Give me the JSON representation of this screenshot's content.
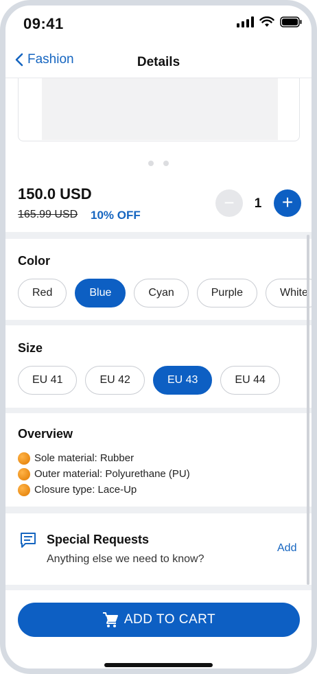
{
  "status_bar": {
    "time": "09:41"
  },
  "nav": {
    "back_label": "Fashion",
    "title": "Details"
  },
  "gallery": {
    "pages": 2
  },
  "price": {
    "current": "150.0 USD",
    "original": "165.99 USD",
    "discount": "10% OFF"
  },
  "quantity": {
    "minus": "−",
    "value": "1",
    "plus": "+"
  },
  "color": {
    "title": "Color",
    "options": [
      "Red",
      "Blue",
      "Cyan",
      "Purple",
      "White"
    ],
    "selected": "Blue"
  },
  "size": {
    "title": "Size",
    "options": [
      "EU 41",
      "EU 42",
      "EU 43",
      "EU 44"
    ],
    "selected": "EU 43"
  },
  "overview": {
    "title": "Overview",
    "items": [
      "Sole material: Rubber",
      "Outer material: Polyurethane (PU)",
      "Closure type: Lace-Up"
    ]
  },
  "special_requests": {
    "title": "Special Requests",
    "subtitle": "Anything else we need to know?",
    "action": "Add"
  },
  "cta": {
    "label": "ADD TO CART"
  },
  "colors": {
    "accent": "#0d5fc3",
    "link": "#1565c0"
  }
}
